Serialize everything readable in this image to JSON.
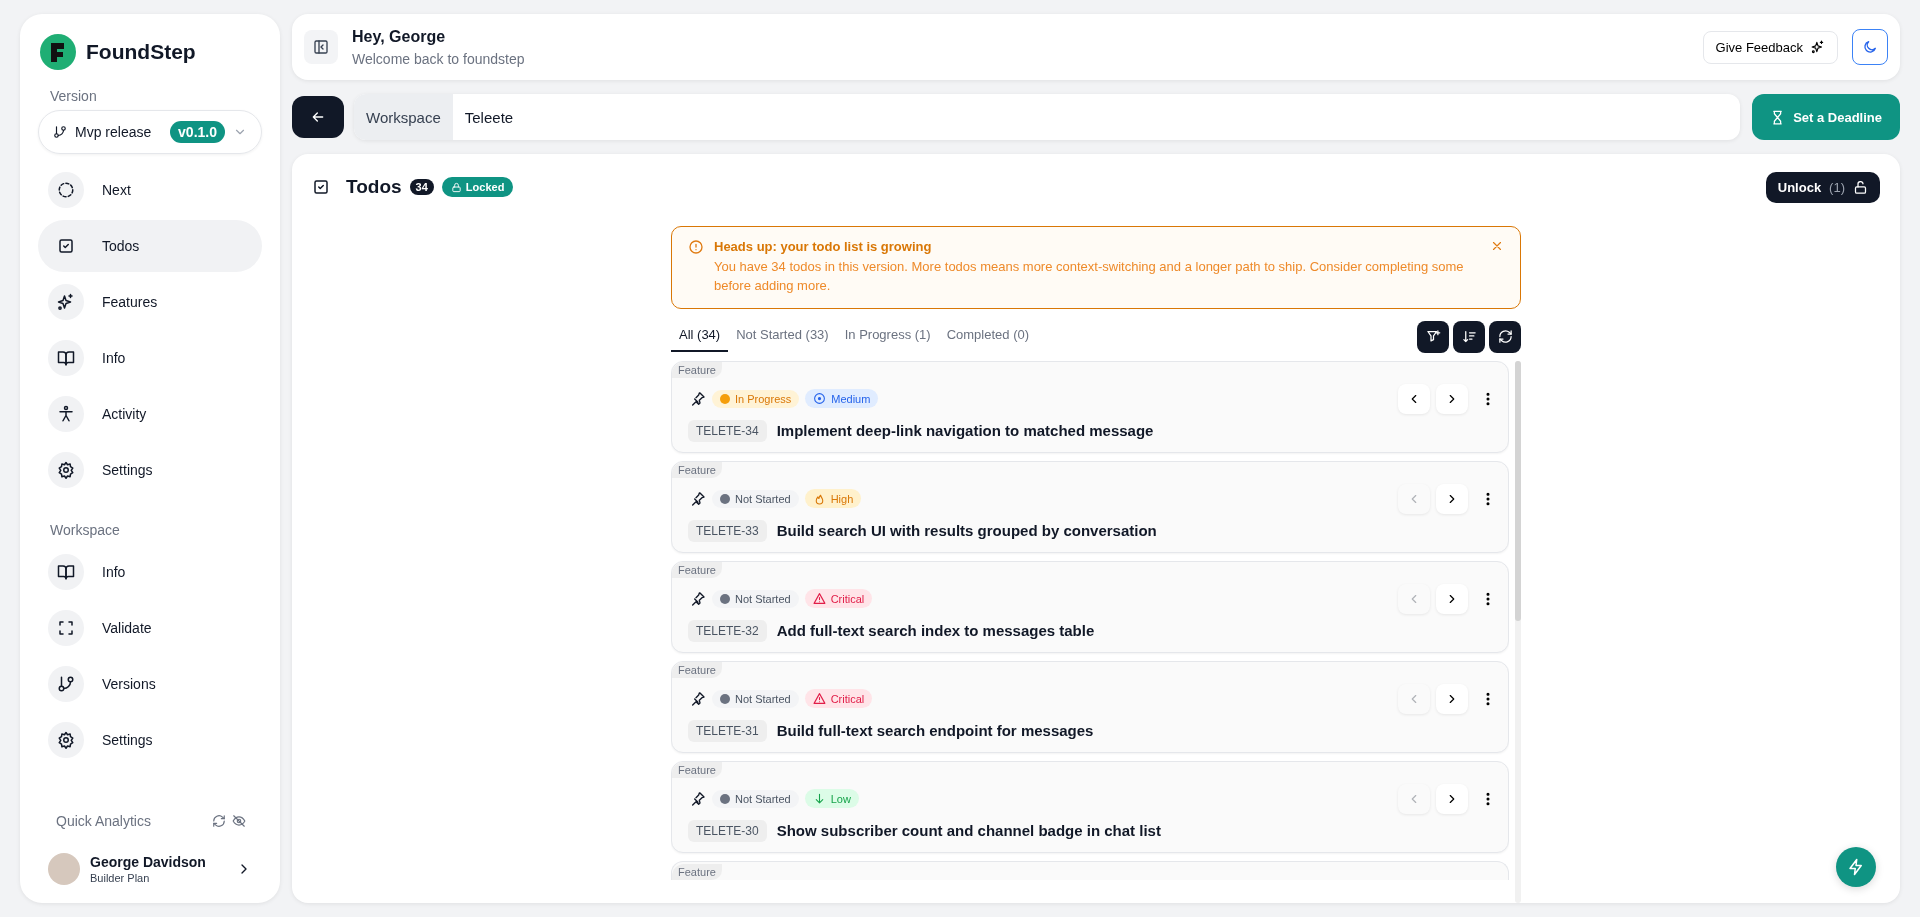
{
  "brand": {
    "name": "FoundStep"
  },
  "sidebar": {
    "version_label": "Version",
    "version_select": {
      "name": "Mvp release",
      "badge": "v0.1.0"
    },
    "version_items": [
      {
        "label": "Next",
        "selected": false
      },
      {
        "label": "Todos",
        "selected": true
      },
      {
        "label": "Features",
        "selected": false
      },
      {
        "label": "Info",
        "selected": false
      },
      {
        "label": "Activity",
        "selected": false
      },
      {
        "label": "Settings",
        "selected": false
      }
    ],
    "workspace_label": "Workspace",
    "workspace_items": [
      {
        "label": "Info",
        "selected": false
      },
      {
        "label": "Validate",
        "selected": false
      },
      {
        "label": "Versions",
        "selected": false
      },
      {
        "label": "Settings",
        "selected": false
      }
    ],
    "analytics": {
      "label": "Quick Analytics"
    },
    "user": {
      "name": "George Davidson",
      "plan": "Builder Plan"
    }
  },
  "header": {
    "title": "Hey, George",
    "subtitle": "Welcome back to foundstep",
    "feedback_button": "Give Feedback"
  },
  "workspace_bar": {
    "label": "Workspace",
    "value": "Teleete",
    "deadline_button": "Set a Deadline"
  },
  "todos": {
    "title": "Todos",
    "count": "34",
    "lock_badge": "Locked",
    "unlock_button": "Unlock",
    "unlock_count": "(1)",
    "alert": {
      "title": "Heads up: your todo list is growing",
      "message": "You have 34 todos in this version. More todos means more context-switching and a longer path to ship. Consider completing some before adding more."
    },
    "tabs": [
      {
        "label": "All (34)",
        "selected": true
      },
      {
        "label": "Not Started (33)",
        "selected": false
      },
      {
        "label": "In Progress (1)",
        "selected": false
      },
      {
        "label": "Completed (0)",
        "selected": false
      }
    ],
    "items": [
      {
        "tag": "Feature",
        "status": {
          "kind": "in_progress",
          "label": "In Progress"
        },
        "priority": {
          "kind": "medium",
          "label": "Medium"
        },
        "key": "TELETE-34",
        "title": "Implement deep-link navigation to matched message",
        "prev_disabled": false
      },
      {
        "tag": "Feature",
        "status": {
          "kind": "not_started",
          "label": "Not Started"
        },
        "priority": {
          "kind": "high",
          "label": "High"
        },
        "key": "TELETE-33",
        "title": "Build search UI with results grouped by conversation",
        "prev_disabled": true
      },
      {
        "tag": "Feature",
        "status": {
          "kind": "not_started",
          "label": "Not Started"
        },
        "priority": {
          "kind": "critical",
          "label": "Critical"
        },
        "key": "TELETE-32",
        "title": "Add full-text search index to messages table",
        "prev_disabled": true
      },
      {
        "tag": "Feature",
        "status": {
          "kind": "not_started",
          "label": "Not Started"
        },
        "priority": {
          "kind": "critical",
          "label": "Critical"
        },
        "key": "TELETE-31",
        "title": "Build full-text search endpoint for messages",
        "prev_disabled": true
      },
      {
        "tag": "Feature",
        "status": {
          "kind": "not_started",
          "label": "Not Started"
        },
        "priority": {
          "kind": "low",
          "label": "Low"
        },
        "key": "TELETE-30",
        "title": "Show subscriber count and channel badge in chat list",
        "prev_disabled": true
      }
    ],
    "next_item_tag": "Feature"
  }
}
